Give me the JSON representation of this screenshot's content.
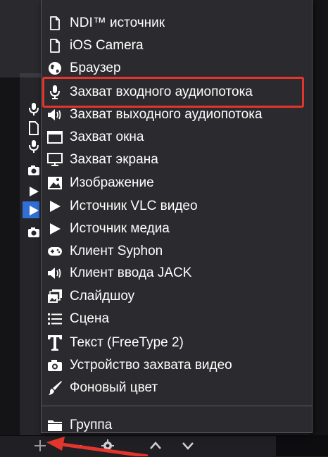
{
  "menu": {
    "items": [
      {
        "label": "NDI™ источник",
        "icon": "file-icon"
      },
      {
        "label": "iOS Camera",
        "icon": "file-icon"
      },
      {
        "label": "Браузер",
        "icon": "globe-icon"
      },
      {
        "label": "Захват входного аудиопотока",
        "icon": "microphone-icon"
      },
      {
        "label": "Захват выходного аудиопотока",
        "icon": "speaker-icon"
      },
      {
        "label": "Захват окна",
        "icon": "window-icon"
      },
      {
        "label": "Захват экрана",
        "icon": "monitor-icon"
      },
      {
        "label": "Изображение",
        "icon": "image-icon"
      },
      {
        "label": "Источник VLC видео",
        "icon": "play-icon"
      },
      {
        "label": "Источник медиа",
        "icon": "play-icon"
      },
      {
        "label": "Клиент Syphon",
        "icon": "gamepad-icon"
      },
      {
        "label": "Клиент ввода JACK",
        "icon": "speaker-icon"
      },
      {
        "label": "Слайдшоу",
        "icon": "slideshow-icon"
      },
      {
        "label": "Сцена",
        "icon": "list-icon"
      },
      {
        "label": "Текст (FreeType 2)",
        "icon": "text-icon"
      },
      {
        "label": "Устройство захвата видео",
        "icon": "camera-icon"
      },
      {
        "label": "Фоновый цвет",
        "icon": "brush-icon"
      }
    ],
    "group_item": {
      "label": "Группа",
      "icon": "folder-icon"
    }
  },
  "annotation": {
    "highlight_color": "#e2352b",
    "highlighted_item": "Захват входного аудиопотока"
  },
  "bottom_toolbar": {
    "buttons": [
      "add-icon",
      "remove-icon",
      "settings-icon",
      "move-up-icon",
      "move-down-icon"
    ]
  },
  "colors": {
    "menu_bg": "#2b2b2f",
    "selected_source": "#2f6fd6"
  }
}
